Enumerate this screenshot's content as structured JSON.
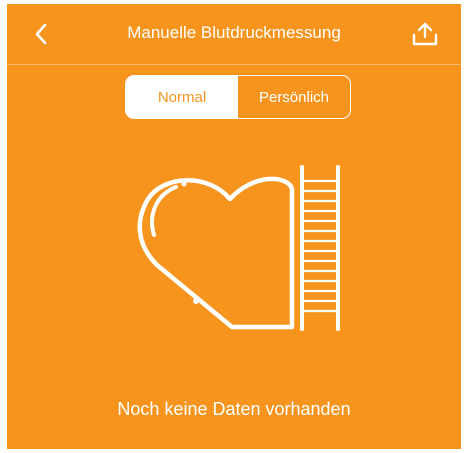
{
  "header": {
    "title": "Manuelle Blutdruckmessung",
    "back_icon": "chevron-left-icon",
    "share_icon": "upload-icon"
  },
  "tabs": [
    {
      "label": "Normal",
      "selected": true
    },
    {
      "label": "Persönlich",
      "selected": false
    }
  ],
  "empty_state": {
    "illustration": "heart-ladder-illustration",
    "message": "Noch keine Daten vorhanden"
  },
  "colors": {
    "background": "#F7941E",
    "foreground": "#FFFFFF"
  }
}
